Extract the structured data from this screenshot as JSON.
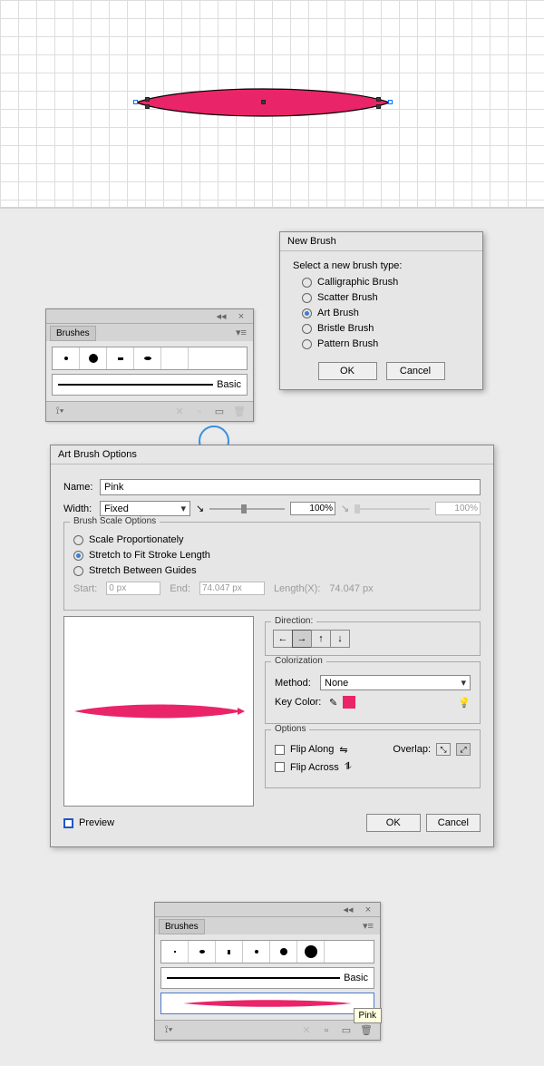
{
  "canvas": {
    "shape_color": "#ea2469"
  },
  "brushes_panel_1": {
    "title": "Brushes",
    "basic_label": "Basic"
  },
  "brushes_panel_2": {
    "title": "Brushes",
    "basic_label": "Basic",
    "tooltip": "Pink"
  },
  "new_brush_dialog": {
    "title": "New Brush",
    "prompt": "Select a new brush type:",
    "options": [
      "Calligraphic Brush",
      "Scatter Brush",
      "Art Brush",
      "Bristle Brush",
      "Pattern Brush"
    ],
    "selected_index": 2,
    "ok": "OK",
    "cancel": "Cancel"
  },
  "art_brush_dialog": {
    "title": "Art Brush Options",
    "name_label": "Name:",
    "name_value": "Pink",
    "width_label": "Width:",
    "width_mode": "Fixed",
    "width_pct_a": "100%",
    "width_pct_b": "100%",
    "scale_legend": "Brush Scale Options",
    "scale_opts": [
      "Scale Proportionately",
      "Stretch to Fit Stroke Length",
      "Stretch Between Guides"
    ],
    "scale_selected": 1,
    "start_label": "Start:",
    "start_val": "0 px",
    "end_label": "End:",
    "end_val": "74.047 px",
    "length_label": "Length(X):",
    "length_val": "74.047 px",
    "direction_legend": "Direction:",
    "colorization_legend": "Colorization",
    "method_label": "Method:",
    "method_value": "None",
    "keycolor_label": "Key Color:",
    "keycolor_hex": "#ea2469",
    "options_legend": "Options",
    "flip_along": "Flip Along",
    "flip_across": "Flip Across",
    "overlap_label": "Overlap:",
    "preview_label": "Preview",
    "ok": "OK",
    "cancel": "Cancel"
  }
}
